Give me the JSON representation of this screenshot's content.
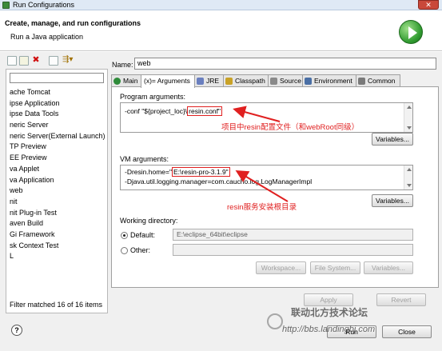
{
  "window": {
    "title": "Run Configurations",
    "close_label": "✕"
  },
  "header": {
    "title": "Create, manage, and run configurations",
    "subtitle": "Run a Java application"
  },
  "left": {
    "tree": [
      "ache Tomcat",
      "ipse Application",
      "ipse Data Tools",
      "neric Server",
      "neric Server(External Launch)",
      "TP Preview",
      "EE Preview",
      "va Applet",
      "va Application",
      "web",
      "nit",
      "nit Plug-in Test",
      "aven Build",
      "Gi Framework",
      "sk Context Test",
      "L"
    ],
    "filter_status": "Filter matched 16 of 16 items"
  },
  "name": {
    "label": "Name:",
    "value": "web"
  },
  "tabs": [
    "Main",
    "(x)= Arguments",
    "JRE",
    "Classpath",
    "Source",
    "Environment",
    "Common"
  ],
  "program_args": {
    "label": "Program arguments:",
    "line1_prefix": "-conf \"${project_loc}\\",
    "line1_box": "resin.conf\"",
    "variables": "Variables..."
  },
  "vm_args": {
    "label": "VM arguments:",
    "line1_prefix": "-Dresin.home=\"",
    "line1_box": "E:\\resin-pro-3.1.9\"",
    "line2": "-Djava.util.logging.manager=com.caucho.log.LogManagerImpl",
    "variables": "Variables..."
  },
  "annotations": {
    "program": "项目中resin配置文件（和webRoot同级）",
    "vm": "resin服务安装根目录"
  },
  "workdir": {
    "label": "Working directory:",
    "default_label": "Default:",
    "default_value": "E:\\eclipse_64bit\\eclipse",
    "other_label": "Other:",
    "workspace": "Workspace...",
    "filesystem": "File System...",
    "variables": "Variables..."
  },
  "buttons": {
    "apply": "Apply",
    "revert": "Revert",
    "run": "Run",
    "close": "Close",
    "help": "?"
  },
  "watermark": {
    "text": "联动北方技术论坛",
    "url": "http://bbs.landingbj.com"
  },
  "colors": {
    "annotation": "#e02020",
    "tab_active": "#ffffff"
  }
}
